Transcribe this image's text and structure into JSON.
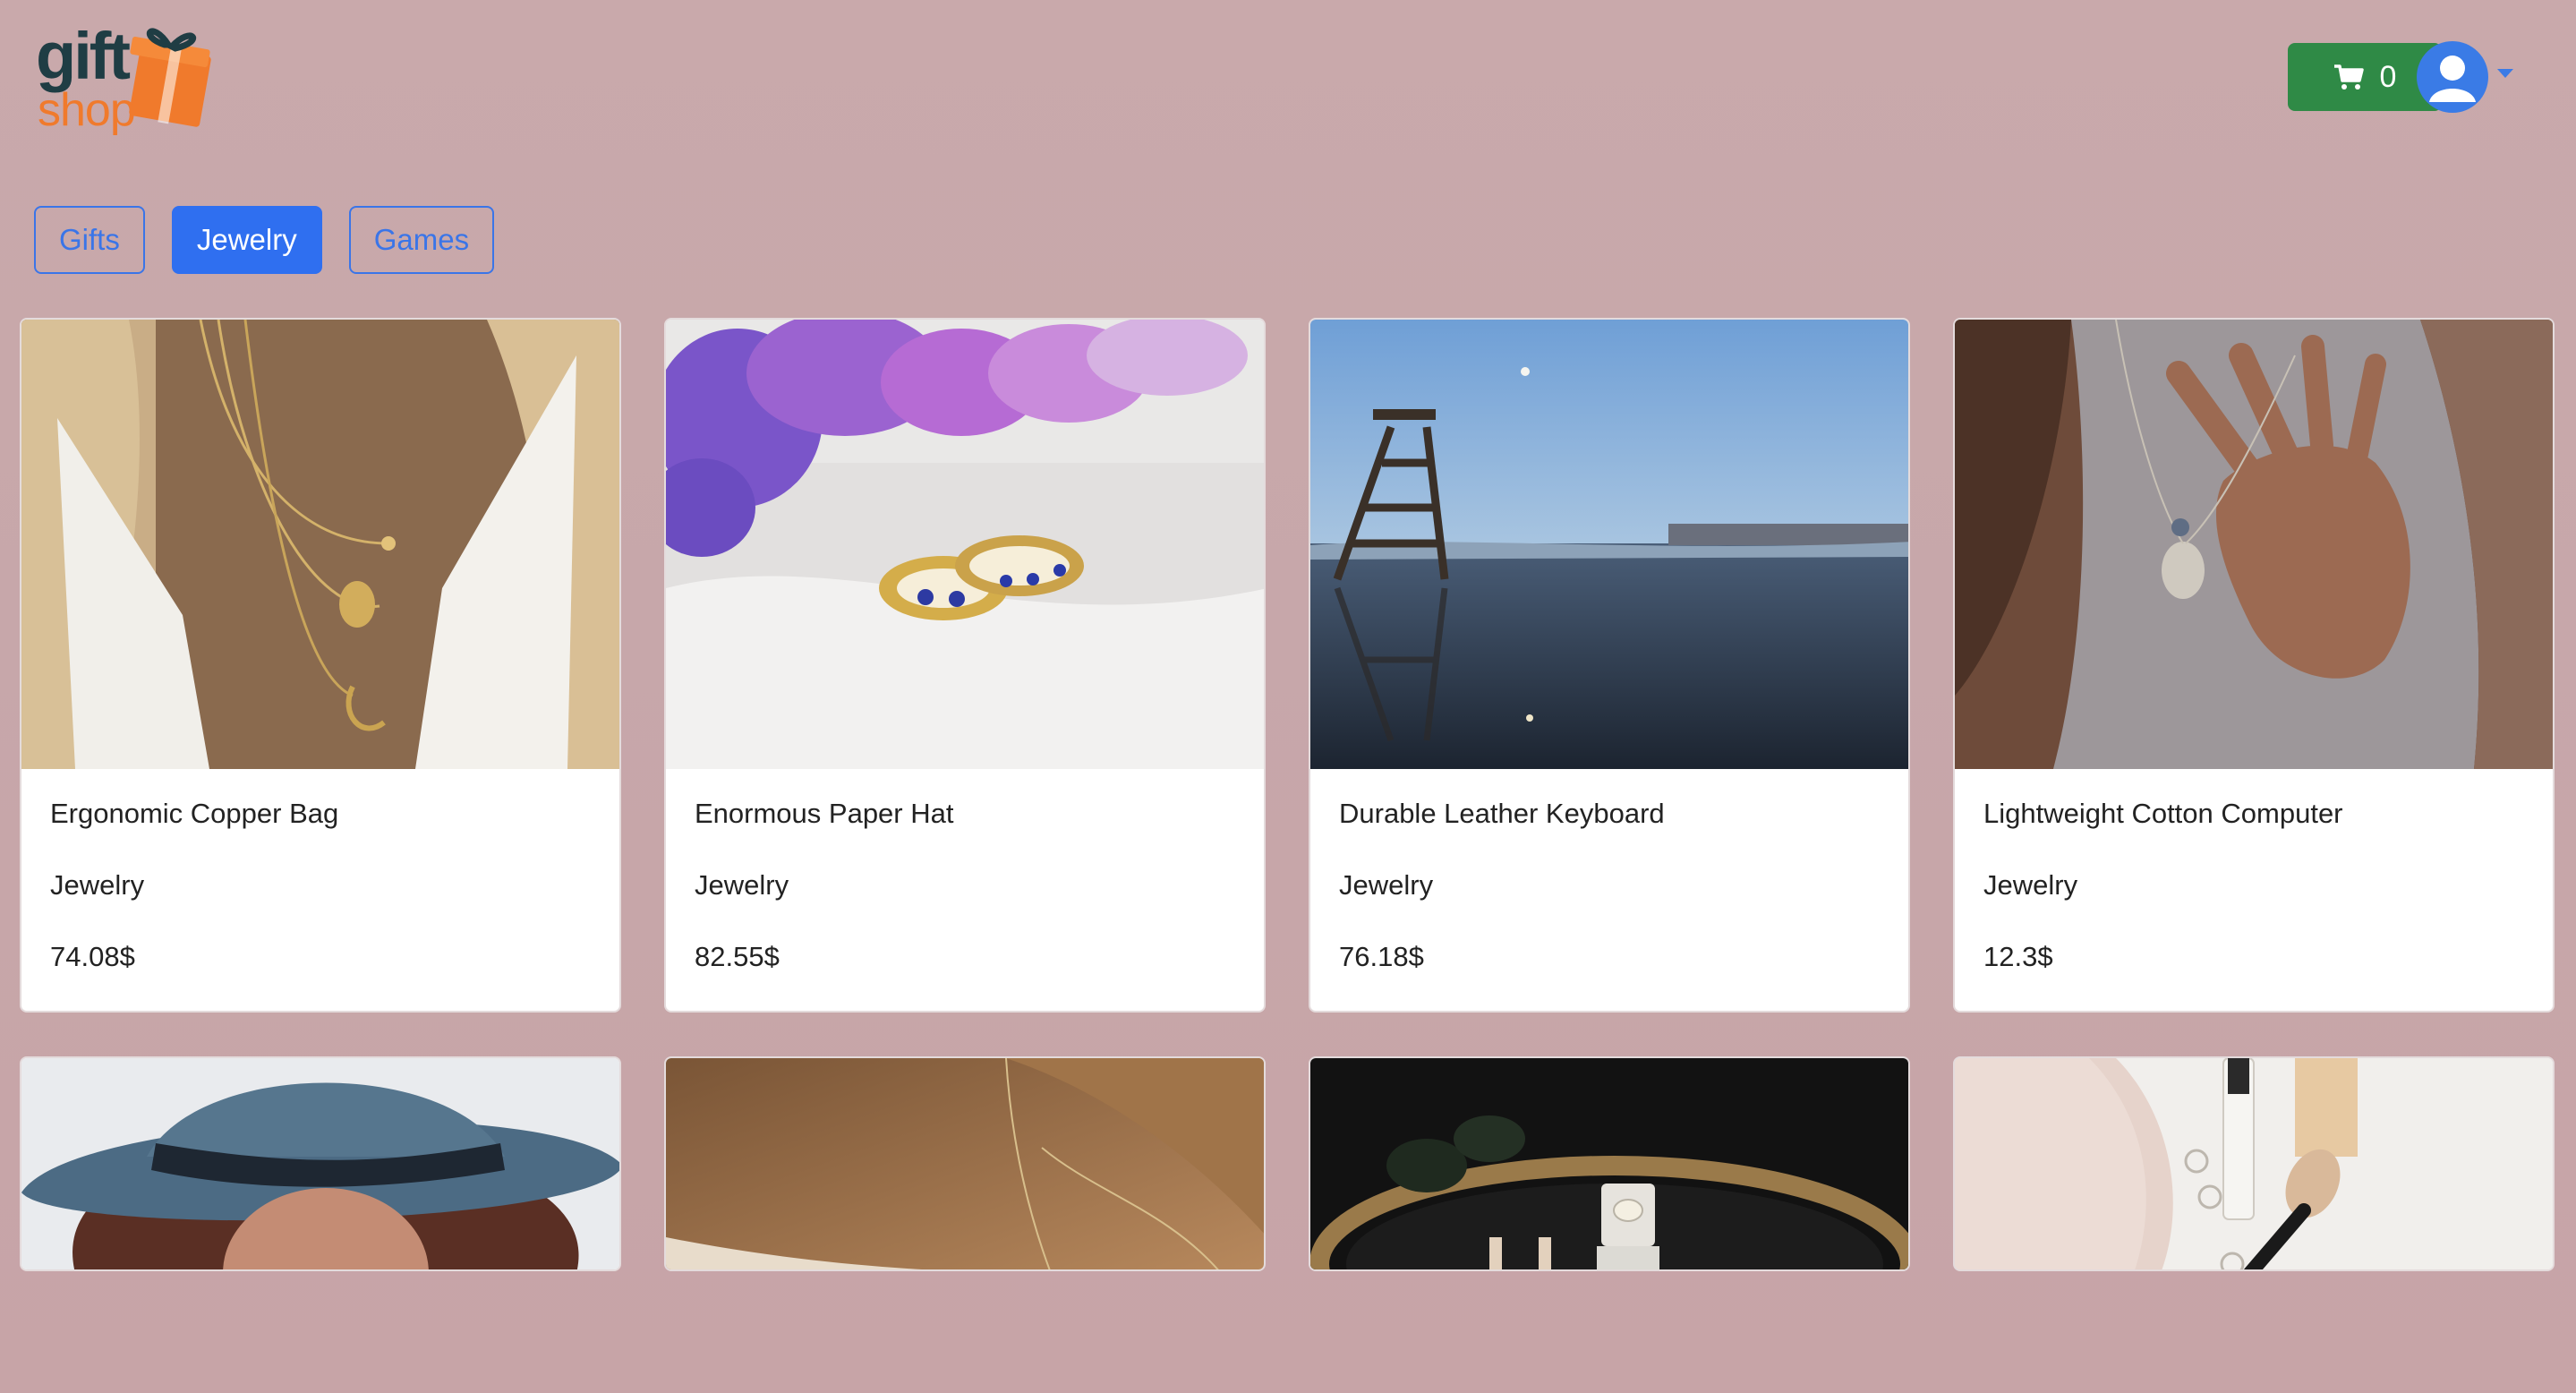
{
  "header": {
    "logo": {
      "line1": "gift",
      "line2": "shop",
      "icon": "gift-box-icon"
    },
    "cart": {
      "icon": "shopping-cart-icon",
      "count": "0"
    },
    "account": {
      "icon": "user-avatar-icon",
      "dropdown_icon": "caret-down-icon"
    }
  },
  "categories": {
    "items": [
      {
        "label": "Gifts",
        "active": false
      },
      {
        "label": "Jewelry",
        "active": true
      },
      {
        "label": "Games",
        "active": false
      }
    ]
  },
  "products": [
    {
      "name": "Ergonomic Copper Bag",
      "category": "Jewelry",
      "price": "74.08$",
      "image": "layered-gold-necklaces-photo"
    },
    {
      "name": "Enormous Paper Hat",
      "category": "Jewelry",
      "price": "82.55$",
      "image": "sapphire-rings-with-flowers-photo"
    },
    {
      "name": "Durable Leather Keyboard",
      "category": "Jewelry",
      "price": "76.18$",
      "image": "lifeguard-tower-beach-photo"
    },
    {
      "name": "Lightweight Cotton Computer",
      "category": "Jewelry",
      "price": "12.3$",
      "image": "hand-with-pendant-necklace-photo"
    },
    {
      "image": "woman-in-blue-hat-photo"
    },
    {
      "image": "neck-with-chain-photo"
    },
    {
      "image": "ring-box-on-ornate-tray-photo"
    },
    {
      "image": "laptop-makeup-rings-flatlay-photo"
    }
  ],
  "colors": {
    "background": "#c9a9ab",
    "primary": "#2f6ff0",
    "cart_green": "#2f8a46",
    "logo_dark": "#1f3d44",
    "logo_orange": "#f07a2c"
  }
}
